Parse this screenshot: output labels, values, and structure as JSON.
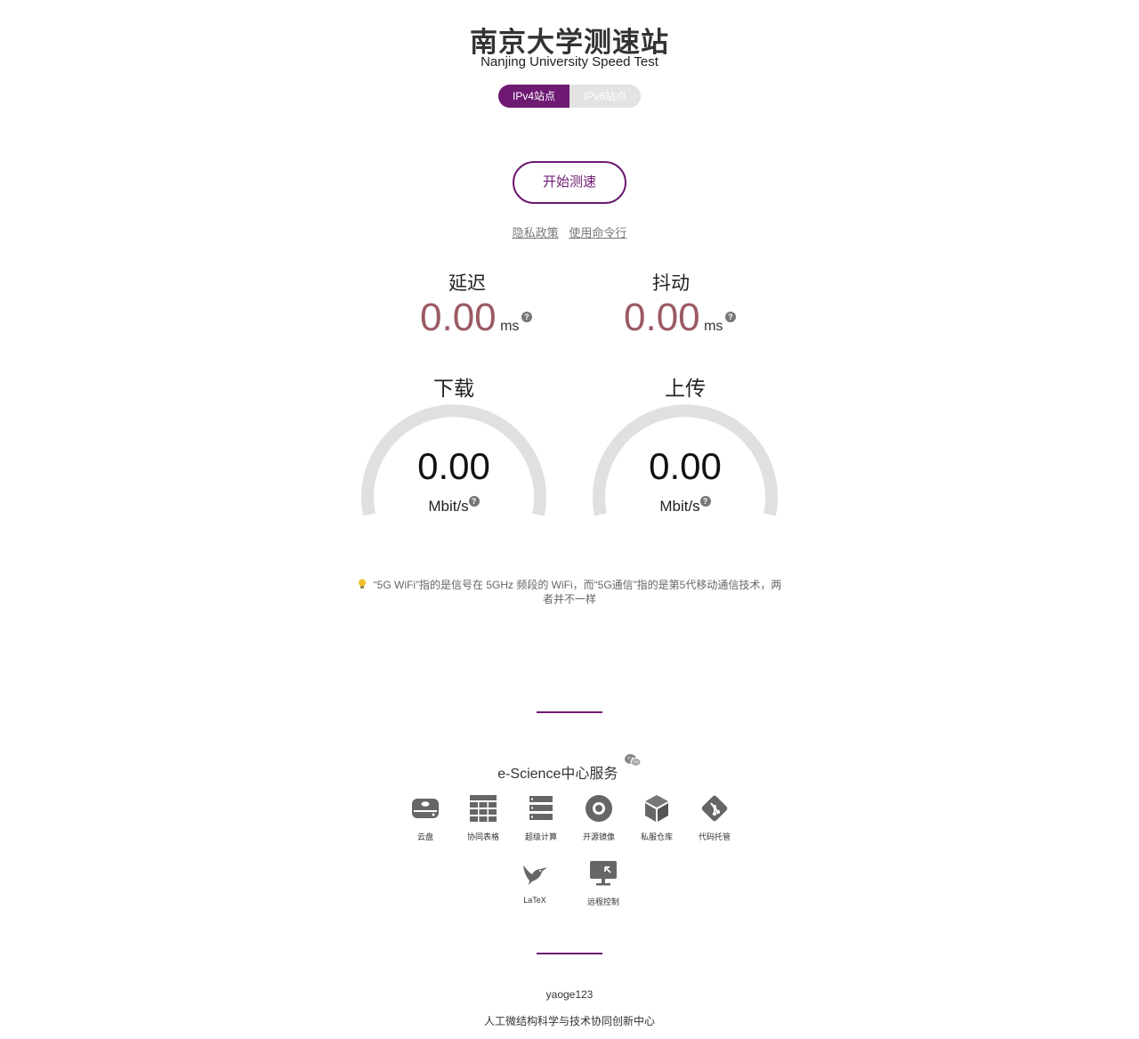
{
  "header": {
    "title": "南京大学测速站",
    "subtitle": "Nanjing University Speed Test"
  },
  "toggle": {
    "ipv4": "IPv4站点",
    "ipv6": "IPv6站点"
  },
  "start_button": "开始测速",
  "links": {
    "privacy": "隐私政策",
    "cli": "使用命令行"
  },
  "metrics": {
    "latency": {
      "label": "延迟",
      "value": "0.00",
      "unit": "ms"
    },
    "jitter": {
      "label": "抖动",
      "value": "0.00",
      "unit": "ms"
    }
  },
  "gauges": {
    "download": {
      "label": "下载",
      "value": "0.00",
      "unit": "Mbit/s"
    },
    "upload": {
      "label": "上传",
      "value": "0.00",
      "unit": "Mbit/s"
    }
  },
  "help_glyph": "?",
  "tip": "“5G WiFi”指的是信号在 5GHz 频段的 WiFi，而“5G通信”指的是第5代移动通信技术，两者并不一样",
  "services": {
    "title": "e-Science中心服务",
    "items": [
      {
        "label": "云盘",
        "icon": "cloud-drive-icon"
      },
      {
        "label": "协同表格",
        "icon": "table-grid-icon"
      },
      {
        "label": "超级计算",
        "icon": "server-stack-icon"
      },
      {
        "label": "开源镜像",
        "icon": "disc-mirror-icon"
      },
      {
        "label": "私服仓库",
        "icon": "package-box-icon"
      },
      {
        "label": "代码托管",
        "icon": "git-icon"
      },
      {
        "label": "LaTeX",
        "icon": "hummingbird-icon"
      },
      {
        "label": "远程控制",
        "icon": "remote-desktop-icon"
      }
    ]
  },
  "footer": {
    "author": "yaoge123",
    "org": "人工微结构科学与技术协同创新中心"
  },
  "colors": {
    "accent": "#6e1a73",
    "metric_value": "#9b5a62",
    "gauge_track": "#e0e0e0"
  }
}
